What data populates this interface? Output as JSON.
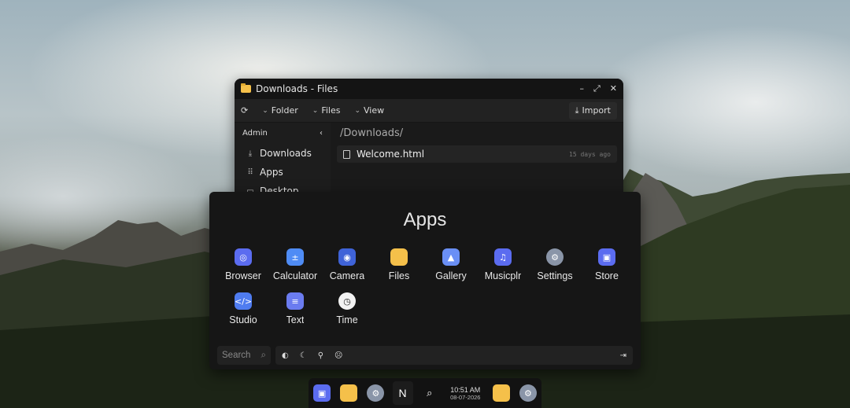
{
  "files_window": {
    "title": "Downloads - Files",
    "controls": [
      "–",
      "⤢",
      "✕"
    ],
    "toolbar": {
      "refresh_icon": "⟳",
      "folder": "Folder",
      "files": "Files",
      "view": "View",
      "import": "Import"
    },
    "sidebar": {
      "header": "Admin",
      "collapse_icon": "‹",
      "items": [
        {
          "label": "Downloads",
          "icon": "⤓"
        },
        {
          "label": "Apps",
          "icon": "⠿"
        },
        {
          "label": "Desktop",
          "icon": "▭"
        }
      ]
    },
    "path": "/Downloads/",
    "files": [
      {
        "name": "Welcome.html",
        "date": "15 days ago"
      }
    ]
  },
  "launcher": {
    "title": "Apps",
    "apps": [
      {
        "label": "Browser",
        "glyph": "◎",
        "color": "#5b6cf0"
      },
      {
        "label": "Calculator",
        "glyph": "±",
        "color": "#4f8cf5"
      },
      {
        "label": "Camera",
        "glyph": "◉",
        "color": "#3f63d8"
      },
      {
        "label": "Files",
        "glyph": "",
        "color": "#f5c04a"
      },
      {
        "label": "Gallery",
        "glyph": "▲",
        "color": "#6a8ff5"
      },
      {
        "label": "Musicplr",
        "glyph": "♫",
        "color": "#5b6cf0"
      },
      {
        "label": "Settings",
        "glyph": "⚙",
        "color": "#8a95a8"
      },
      {
        "label": "Store",
        "glyph": "▣",
        "color": "#5b6cf0"
      },
      {
        "label": "Studio",
        "glyph": "</>",
        "color": "#4f7cf0"
      },
      {
        "label": "Text",
        "glyph": "≡",
        "color": "#6b7cf0"
      },
      {
        "label": "Time",
        "glyph": "◷",
        "color": "#f2f2f2"
      }
    ],
    "search_placeholder": "Search",
    "search_icon": "⌕",
    "quick_icons": [
      "◐",
      "☾",
      "⚲",
      "☹"
    ],
    "logout_icon": "⇥"
  },
  "taskbar": {
    "time": "10:51 AM",
    "date": "08-07-2026",
    "start_glyph": "N",
    "search_glyph": "⌕"
  }
}
